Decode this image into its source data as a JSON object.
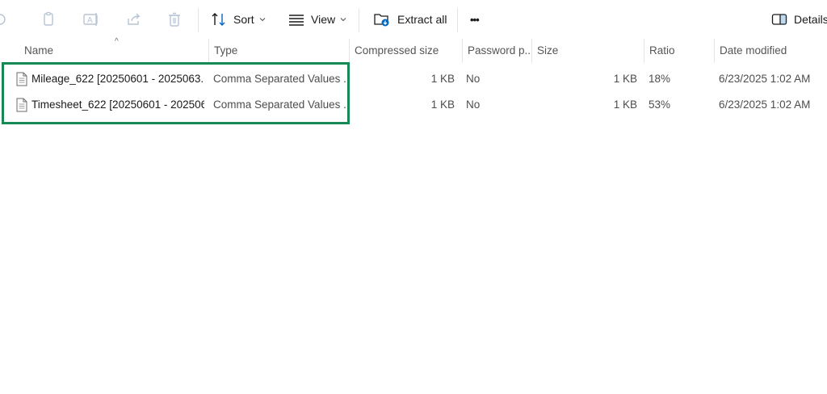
{
  "toolbar": {
    "sort_label": "Sort",
    "view_label": "View",
    "extract_label": "Extract all",
    "more_label": "•••",
    "details_label": "Details"
  },
  "columns": {
    "name": "Name",
    "type": "Type",
    "compressed": "Compressed size",
    "password": "Password p...",
    "size": "Size",
    "ratio": "Ratio",
    "date": "Date modified"
  },
  "files": [
    {
      "name": "Mileage_622 [20250601 - 2025063...",
      "type": "Comma Separated Values ...",
      "compressed": "1 KB",
      "password": "No",
      "size": "1 KB",
      "ratio": "18%",
      "date": "6/23/2025 1:02 AM"
    },
    {
      "name": "Timesheet_622 [20250601 - 202506...",
      "type": "Comma Separated Values ...",
      "compressed": "1 KB",
      "password": "No",
      "size": "1 KB",
      "ratio": "53%",
      "date": "6/23/2025 1:02 AM"
    }
  ],
  "colors": {
    "highlight": "#168a55",
    "disabled_icon": "#b8c4d6",
    "accent": "#0067c0"
  }
}
